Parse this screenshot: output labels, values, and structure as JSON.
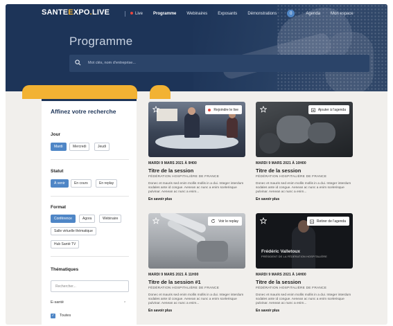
{
  "brand": {
    "logo_left": "SANTE",
    "logo_mid": "XPO",
    "logo_dot": ".",
    "logo_right": "LIVE",
    "logo_e": "E"
  },
  "nav": {
    "items": [
      "Live",
      "Programme",
      "Webinaires",
      "Exposants",
      "Démonstrations"
    ],
    "badge": "0",
    "right_items": [
      "Agenda",
      "Mon espace"
    ]
  },
  "hero": {
    "title": "Programme",
    "search_placeholder": "Mot clés, nom d'entreprise..."
  },
  "filters": {
    "heading": "Affinez votre recherche",
    "jour": {
      "label": "Jour",
      "options": [
        "Mardi",
        "Mercredi",
        "Jeudi"
      ],
      "selected": "Mardi"
    },
    "statut": {
      "label": "Statut",
      "options": [
        "À venir",
        "En cours",
        "En replay"
      ],
      "selected": "À venir"
    },
    "format": {
      "label": "Format",
      "options": [
        "Conférence",
        "Agora",
        "Webinaire",
        "Salle virtuelle thématique",
        "Hub Santé TV"
      ],
      "selected": "Conférence"
    },
    "thematiques": {
      "label": "Thématiques",
      "search_placeholder": "Rechercher...",
      "group": "E-santé",
      "checkbox_label": "Toutes"
    }
  },
  "cards": [
    {
      "action": "Rejoindre le live",
      "date": "MARDI 9 MARS 2021 À 9H00",
      "title": "Titre de la session",
      "org": "FÉDÉRATION HOSPITALIÈRE DE FRANCE",
      "desc": "Donec et mauris sed enim mollis mollis in a dui. Integer interdum sodales ante id congue. Aenean ac nunc a enim scelerisque pulvinar. Aenean ac nunc a enim...",
      "more": "En savoir plus"
    },
    {
      "action": "Ajouter à l'agenda",
      "date": "MARDI 9 MARS 2021 À 10H00",
      "title": "Titre de la session",
      "org": "FÉDÉRATION HOSPITALIÈRE DE FRANCE",
      "desc": "Donec et mauris sed enim mollis mollis in a dui. Integer interdum sodales ante id congue. Aenean ac nunc a enim scelerisque pulvinar. Aenean ac nunc a enim...",
      "more": "En savoir plus"
    },
    {
      "action": "Voir le replay",
      "date": "MARDI 9 MARS 2021 À 11H00",
      "title": "Titre de la session #1",
      "org": "FÉDÉRATION HOSPITALIÈRE DE FRANCE",
      "desc": "Donec et mauris sed enim mollis mollis in a dui. Integer interdum sodales ante id congue. Aenean ac nunc a enim scelerisque pulvinar. Aenean ac nunc a enim...",
      "more": "En savoir plus"
    },
    {
      "action": "Retirer de l'agenda",
      "date": "MARDI 9 MARS 2021 À 14H00",
      "title": "Titre de la session",
      "org": "FÉDÉRATION HOSPITALIÈRE DE FRANCE",
      "desc": "Donec et mauris sed enim mollis mollis in a dui. Integer interdum sodales ante id congue. Aenean ac nunc a enim scelerisque pulvinar. Aenean ac nunc a enim...",
      "more": "En savoir plus",
      "speaker_name": "Frédéric Valletoux",
      "speaker_role": "PRÉSIDENT DE LA FÉDÉRATION HOSPITALIÈRE"
    }
  ],
  "colors": {
    "navy": "#1d3458",
    "accent": "#4f86c6",
    "yellow": "#f2b233",
    "live": "#e8473f"
  }
}
